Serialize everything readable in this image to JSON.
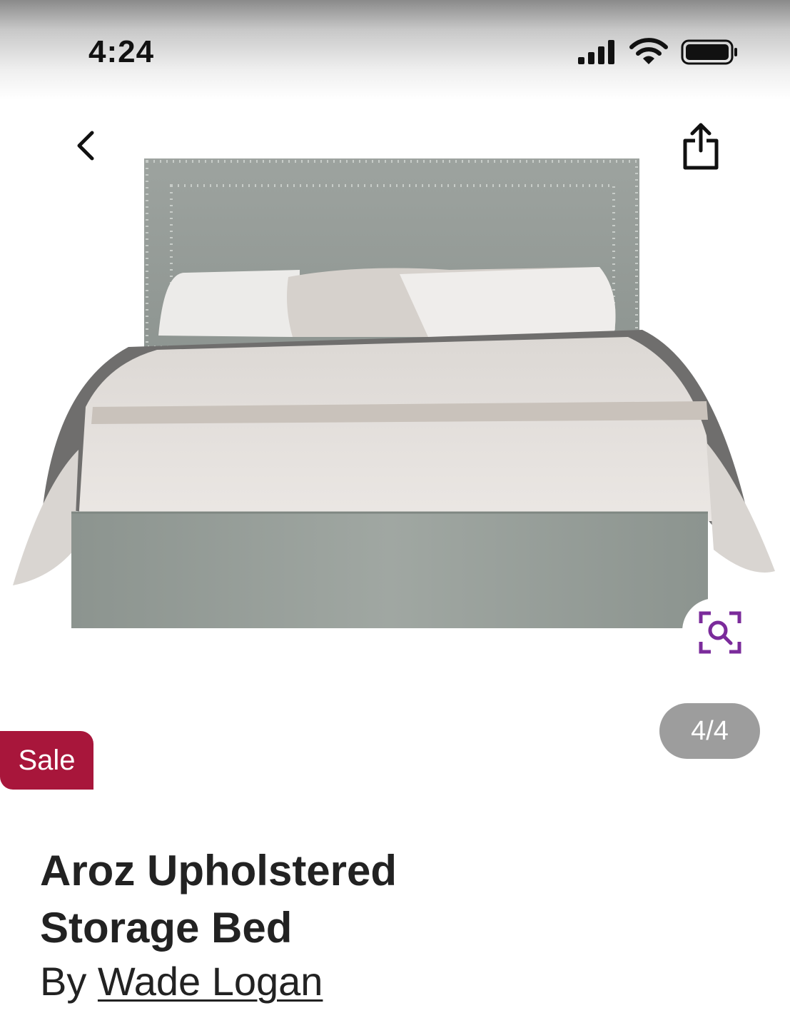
{
  "status_bar": {
    "time": "4:24",
    "signal_icon": "cellular-signal-icon",
    "wifi_icon": "wifi-icon",
    "battery_icon": "battery-icon"
  },
  "navigation": {
    "back_icon": "chevron-left-icon",
    "share_icon": "share-icon"
  },
  "gallery": {
    "image_subject": "grey upholstered bed with nailhead headboard",
    "visual_search_icon": "visual-search-icon",
    "counter": "4/4",
    "accent_color": "#7b2b9b"
  },
  "badge": {
    "label": "Sale",
    "color": "#a8163b"
  },
  "product": {
    "title_line1": "Aroz Upholstered",
    "title_line2": "Storage Bed",
    "by_label": "By",
    "brand": "Wade Logan"
  }
}
